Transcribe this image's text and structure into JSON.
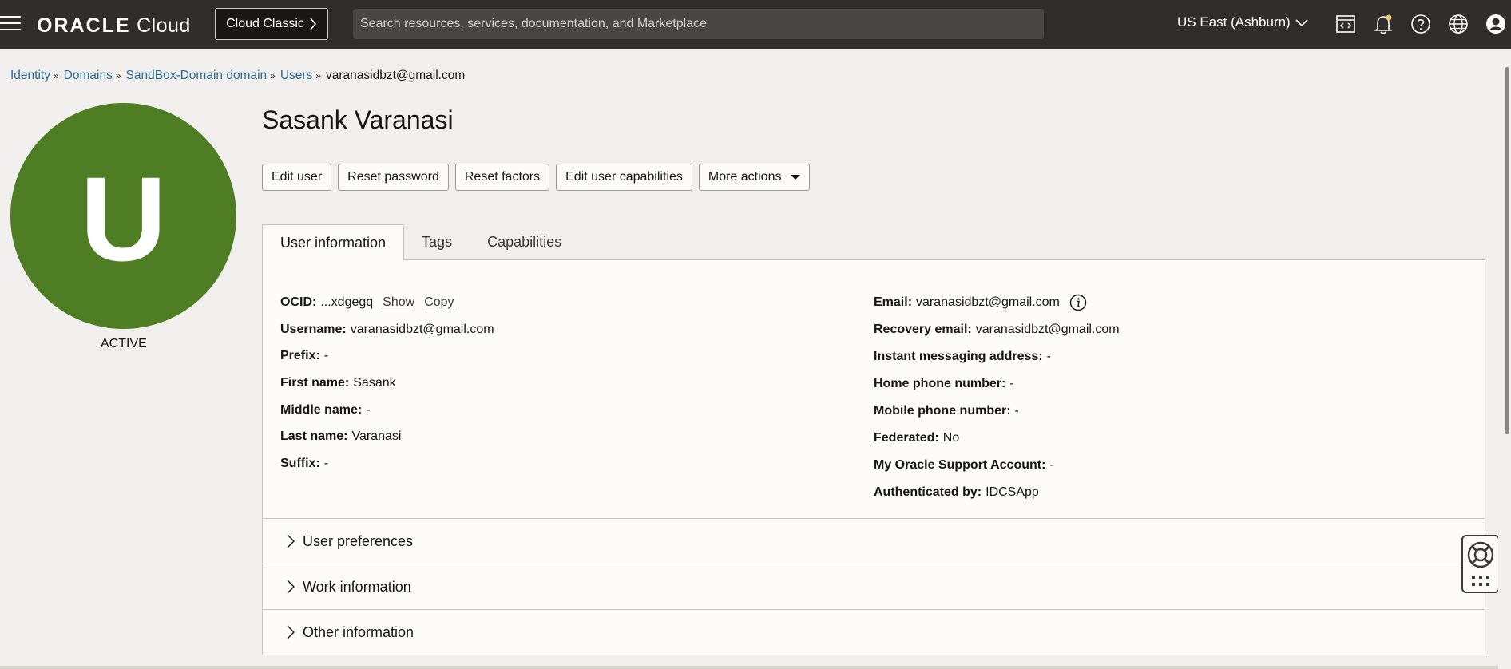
{
  "topbar": {
    "logo_brand": "ORACLE",
    "logo_product": "Cloud",
    "cloud_classic_label": "Cloud Classic",
    "search_placeholder": "Search resources, services, documentation, and Marketplace",
    "region_label": "US East (Ashburn)",
    "icons": [
      "code-editor-icon",
      "bell-icon",
      "help-icon",
      "globe-icon",
      "user-profile-icon"
    ]
  },
  "breadcrumb": {
    "items": [
      "Identity",
      "Domains",
      "SandBox-Domain domain",
      "Users"
    ],
    "current": "varanasidbzt@gmail.com"
  },
  "avatar": {
    "letter": "U",
    "color": "#4e7d24"
  },
  "status": "ACTIVE",
  "page_title": "Sasank Varanasi",
  "actions": {
    "edit_user": "Edit user",
    "reset_password": "Reset password",
    "reset_factors": "Reset factors",
    "edit_capabilities": "Edit user capabilities",
    "more_actions": "More actions"
  },
  "tabs": [
    "User information",
    "Tags",
    "Capabilities"
  ],
  "user_info": {
    "left": [
      {
        "label": "OCID:",
        "value": "...xdgegq"
      },
      {
        "label": "Username:",
        "value": "varanasidbzt@gmail.com"
      },
      {
        "label": "Prefix:",
        "value": "-"
      },
      {
        "label": "First name:",
        "value": "Sasank"
      },
      {
        "label": "Middle name:",
        "value": "-"
      },
      {
        "label": "Last name:",
        "value": "Varanasi"
      },
      {
        "label": "Suffix:",
        "value": "-"
      }
    ],
    "ocid_show": "Show",
    "ocid_copy": "Copy",
    "right": [
      {
        "label": "Email:",
        "value": "varanasidbzt@gmail.com"
      },
      {
        "label": "Recovery email:",
        "value": "varanasidbzt@gmail.com"
      },
      {
        "label": "Instant messaging address:",
        "value": "-"
      },
      {
        "label": "Home phone number:",
        "value": "-"
      },
      {
        "label": "Mobile phone number:",
        "value": "-"
      },
      {
        "label": "Federated:",
        "value": "No"
      },
      {
        "label": "My Oracle Support Account:",
        "value": "-"
      },
      {
        "label": "Authenticated by:",
        "value": "IDCSApp"
      }
    ]
  },
  "accordions": [
    "User preferences",
    "Work information",
    "Other information"
  ],
  "colors": {
    "topbar": "#312d2a",
    "link": "#2b6a8e",
    "avatar": "#4e7d24"
  }
}
